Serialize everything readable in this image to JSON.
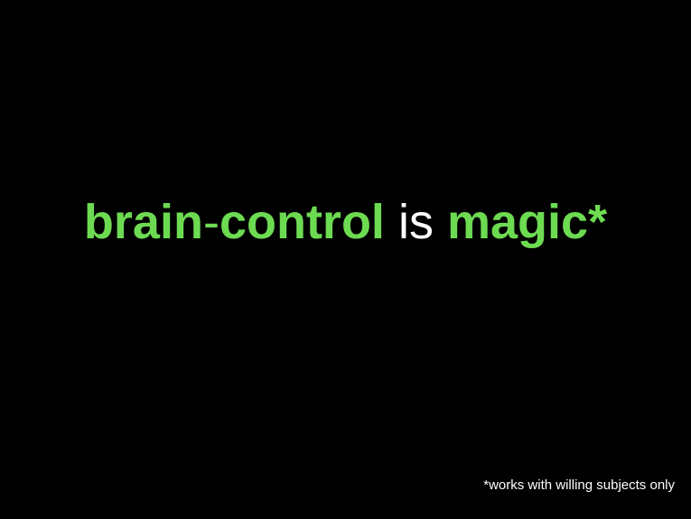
{
  "slide": {
    "headline": {
      "part1": "brain",
      "hyphen": "-",
      "part2": "control",
      "space1": " ",
      "middle": "is",
      "space2": " ",
      "part3": "magic*"
    },
    "footnote": "*works with willing subjects only"
  },
  "colors": {
    "background": "#000000",
    "accent": "#6ddb52",
    "text": "#ffffff"
  }
}
